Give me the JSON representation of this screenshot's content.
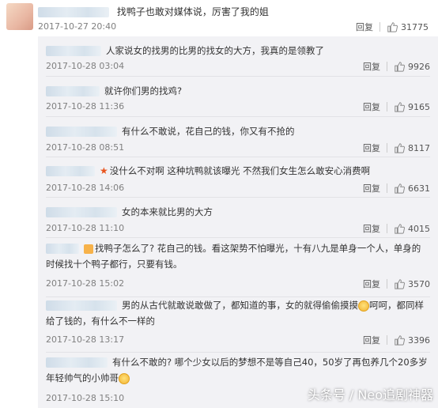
{
  "top": {
    "text": "找鸭子也敢对媒体说，厉害了我的姐",
    "time": "2017-10-27 20:40",
    "reply": "回复",
    "likes": "31775"
  },
  "replies": [
    {
      "text": "人家说女的找男的比男的找女的大方，我真的是领教了",
      "time": "2017-10-28 03:04",
      "reply": "回复",
      "likes": "9926"
    },
    {
      "text": "就许你们男的找鸡?",
      "time": "2017-10-28 11:36",
      "reply": "回复",
      "likes": "9165"
    },
    {
      "text": "有什么不敢说，花自己的钱，你又有不抢的",
      "time": "2017-10-28 08:51",
      "reply": "回复",
      "likes": "8117"
    },
    {
      "text": "没什么不对啊 这种坑鸭就该曝光 不然我们女生怎么敢安心消费啊",
      "time": "2017-10-28 14:06",
      "reply": "回复",
      "likes": "6631"
    },
    {
      "text": "女的本来就比男的大方",
      "time": "2017-10-28 11:10",
      "reply": "回复",
      "likes": "4015"
    },
    {
      "text": "找鸭子怎么了? 花自己的钱。看这架势不怕曝光，十有八九是单身一个人，单身的时候找十个鸭子都行，只要有钱。",
      "time": "2017-10-28 15:02",
      "reply": "回复",
      "likes": "3570"
    },
    {
      "text_a": "男的从古代就敢说敢做了，都知道的事，女的就得偷偷摸摸",
      "text_b": "呵呵，都同样给了钱的，有什么不一样的",
      "time": "2017-10-28 13:17",
      "reply": "回复",
      "likes": "3396"
    },
    {
      "text": "有什么不敢的? 哪个少女以后的梦想不是等自己40，50岁了再包养几个20多岁年轻帅气的小帅哥",
      "time": "2017-10-28 15:10",
      "reply": "回复",
      "likes": ""
    }
  ],
  "watermark": "头条号 / Neo追剧神器",
  "icons": [
    "thumb-up-icon",
    "star-icon",
    "vip-badge-icon",
    "emoji-icon",
    "avatar"
  ]
}
